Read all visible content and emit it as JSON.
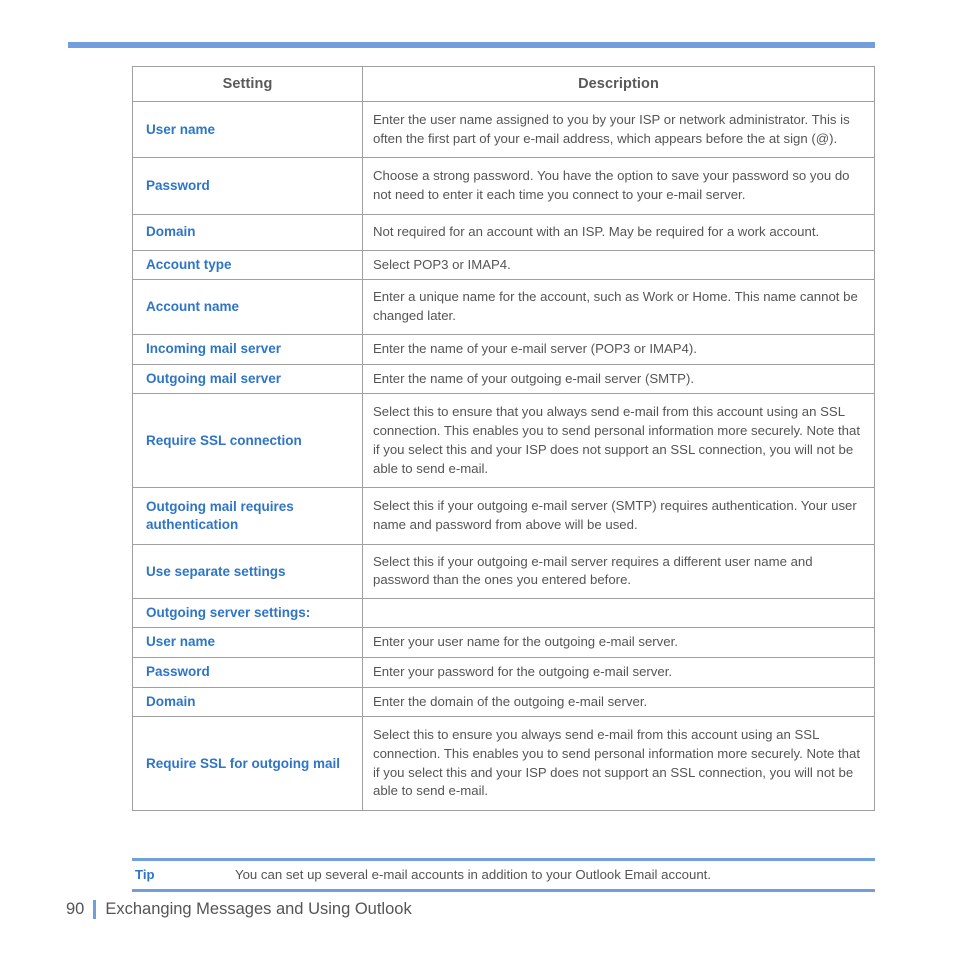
{
  "colors": {
    "accent_blue": "#719fdd",
    "label_blue": "#2e75c8",
    "body_gray": "#555555",
    "header_gray": "#595959",
    "border_gray": "#a0a0a0"
  },
  "table": {
    "headers": {
      "setting": "Setting",
      "description": "Description"
    },
    "rows": [
      {
        "setting": "User name",
        "description": "Enter the user name assigned to you by your ISP or network administrator. This is often the first part of your e-mail address, which appears before the at sign (@).",
        "size": "tall"
      },
      {
        "setting": "Password",
        "description": "Choose a strong password. You have the option to save your password so you do not need to enter it each time you connect to your e-mail server.",
        "size": "tall"
      },
      {
        "setting": "Domain",
        "description": "Not required for an account with an ISP. May be required for a work account.",
        "size": "normal"
      },
      {
        "setting": "Account type",
        "description": "Select POP3 or IMAP4.",
        "size": "short"
      },
      {
        "setting": "Account name",
        "description": "Enter a unique name for the account, such as Work or Home. This name cannot be changed later.",
        "size": "normal"
      },
      {
        "setting": "Incoming mail server",
        "description": "Enter the name of your e-mail server (POP3 or IMAP4).",
        "size": "short"
      },
      {
        "setting": "Outgoing mail server",
        "description": "Enter the name of your outgoing e-mail server (SMTP).",
        "size": "short"
      },
      {
        "setting": "Require SSL connection",
        "description": "Select this to ensure that you always send e-mail from this account using an SSL connection. This enables you to send personal information more securely. Note that if you select this and your ISP does not support an SSL connection, you will not be able to send e-mail.",
        "size": "tall"
      },
      {
        "setting": "Outgoing mail requires authentication",
        "description": "Select this if your outgoing e-mail server (SMTP) requires authentication. Your user name and password from above will be used.",
        "size": "tall"
      },
      {
        "setting": "Use separate settings",
        "description": "Select this if your outgoing e-mail server requires a different user name and password than the ones you entered before.",
        "size": "normal"
      },
      {
        "setting": "Outgoing server settings:",
        "description": "",
        "size": "short"
      },
      {
        "setting": "User name",
        "description": "Enter your user name for the outgoing e-mail server.",
        "size": "short"
      },
      {
        "setting": "Password",
        "description": "Enter your password for the outgoing e-mail server.",
        "size": "short"
      },
      {
        "setting": "Domain",
        "description": "Enter the domain of the outgoing e-mail server.",
        "size": "short"
      },
      {
        "setting": "Require SSL for outgoing mail",
        "description": "Select this to ensure you always send e-mail from this account using an SSL connection. This enables you to send personal information more securely. Note that if you select this and your ISP does not support an SSL connection, you will not be able to send e-mail.",
        "size": "tall"
      }
    ]
  },
  "tip": {
    "label": "Tip",
    "text": "You can set up several e-mail accounts in addition to your Outlook Email account."
  },
  "footer": {
    "page_number": "90",
    "chapter_title": "Exchanging Messages and Using Outlook"
  }
}
